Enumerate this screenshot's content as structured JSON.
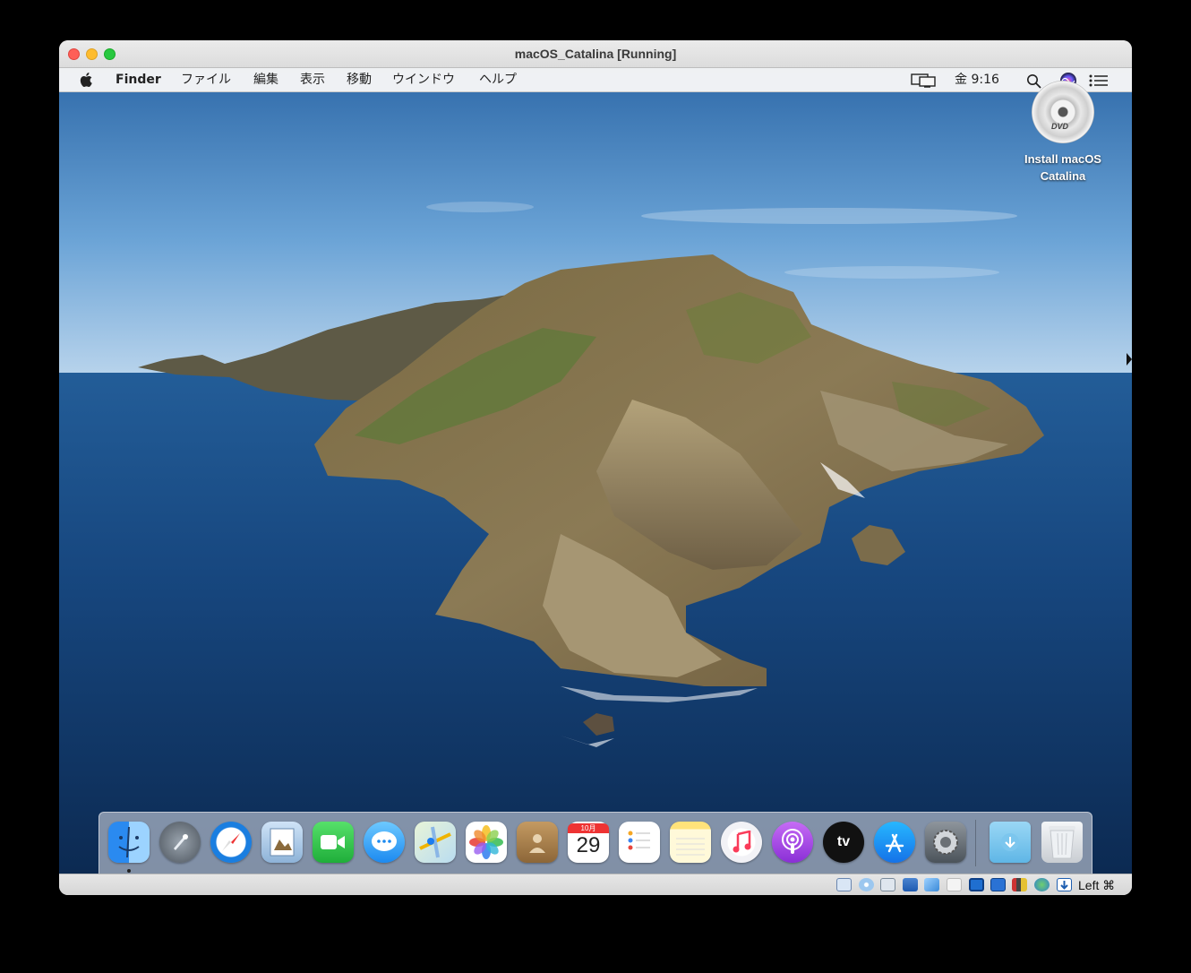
{
  "window": {
    "title": "macOS_Catalina [Running]"
  },
  "menubar": {
    "app_name": "Finder",
    "menus": [
      "ファイル",
      "編集",
      "表示",
      "移動",
      "ウインドウ",
      "ヘルプ"
    ],
    "clock": "金 9:16",
    "status_icons": [
      "display-mirroring-icon",
      "search-icon",
      "siri-icon",
      "notification-center-icon"
    ]
  },
  "desktop": {
    "icon_label_line1": "Install macOS",
    "icon_label_line2": "Catalina",
    "icon_badge": "DVD"
  },
  "dock": {
    "apps": [
      "finder-icon",
      "launchpad-icon",
      "safari-icon",
      "preview-icon",
      "facetime-icon",
      "messages-icon",
      "maps-icon",
      "photos-icon",
      "contacts-icon",
      "calendar-icon",
      "reminders-icon",
      "notes-icon",
      "music-icon",
      "podcasts-icon",
      "tv-icon",
      "app-store-icon",
      "system-preferences-icon",
      "downloads-folder-icon",
      "trash-icon"
    ],
    "calendar_month": "10月",
    "calendar_day": "29",
    "tv_label": "tv"
  },
  "statusbar": {
    "host_key": "Left ⌘"
  },
  "colors": {
    "close": "#fe5f57",
    "minimize": "#febc2e",
    "maximize": "#28c840"
  }
}
